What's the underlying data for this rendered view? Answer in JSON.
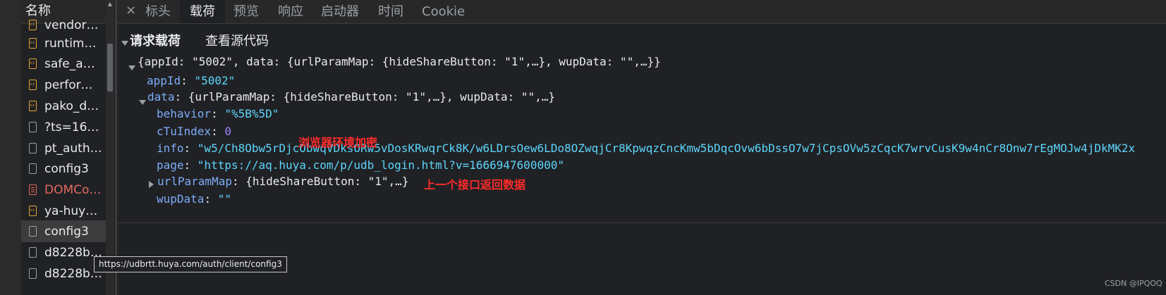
{
  "sidebar": {
    "header": "名称",
    "files": [
      {
        "label": "vendors~..."
      },
      {
        "label": "runtime~..."
      },
      {
        "label": "safe_auth..."
      },
      {
        "label": "performa..."
      },
      {
        "label": "pako_defl..."
      },
      {
        "label": "?ts=1666..."
      },
      {
        "label": "pt_auth.h..."
      },
      {
        "label": "config3"
      },
      {
        "label": "DOMCon..."
      },
      {
        "label": "ya-huya.f..."
      },
      {
        "label": "config3"
      },
      {
        "label": "d8228bd..."
      },
      {
        "label": "d8228bd..."
      }
    ],
    "tooltip": "https://udbrtt.huya.com/auth/client/config3"
  },
  "tabs": {
    "close": "×",
    "items": [
      "标头",
      "载荷",
      "预览",
      "响应",
      "启动器",
      "时间",
      "Cookie"
    ],
    "active": "载荷"
  },
  "payload": {
    "section_title": "请求载荷",
    "view_source": "查看源代码",
    "root_summary": "{appId: \"5002\", data: {urlParamMap: {hideShareButton: \"1\",…}, wupData: \"\",…}}",
    "appId": {
      "key": "appId",
      "value": "\"5002\""
    },
    "data": {
      "key": "data",
      "summary": "{urlParamMap: {hideShareButton: \"1\",…}, wupData: \"\",…}"
    },
    "behavior": {
      "key": "behavior",
      "value": "\"%5B%5D\""
    },
    "cTuIndex": {
      "key": "cTuIndex",
      "value": "0"
    },
    "info": {
      "key": "info",
      "value": "\"w5/Ch8Obw5rDjcObwqVDksORw5vDosKRwqrCk8K/w6LDrsOew6LDo8OZwqjCr8KpwqzCncKmw5bDqcOvw6bDssO7w7jCpsOVw5zCqcK7wrvCusK9w4nCr8Onw7rEgMOJw4jDkMK2x"
    },
    "page": {
      "key": "page",
      "value": "\"https://aq.huya.com/p/udb_login.html?v=1666947600000\""
    },
    "urlParamMap": {
      "key": "urlParamMap",
      "summary": "{hideShareButton: \"1\",…}"
    },
    "wupData": {
      "key": "wupData",
      "value": "\"\""
    }
  },
  "annotations": {
    "browser_env": "浏览器环境加密",
    "prev_api": "上一个接口返回数据"
  },
  "watermark": "CSDN @IPQOQ",
  "colors": {
    "background": "#202124",
    "key": "#7cacf8",
    "string": "#5cd5fb",
    "number": "#9980ff",
    "annotation": "#ff2b2b"
  }
}
